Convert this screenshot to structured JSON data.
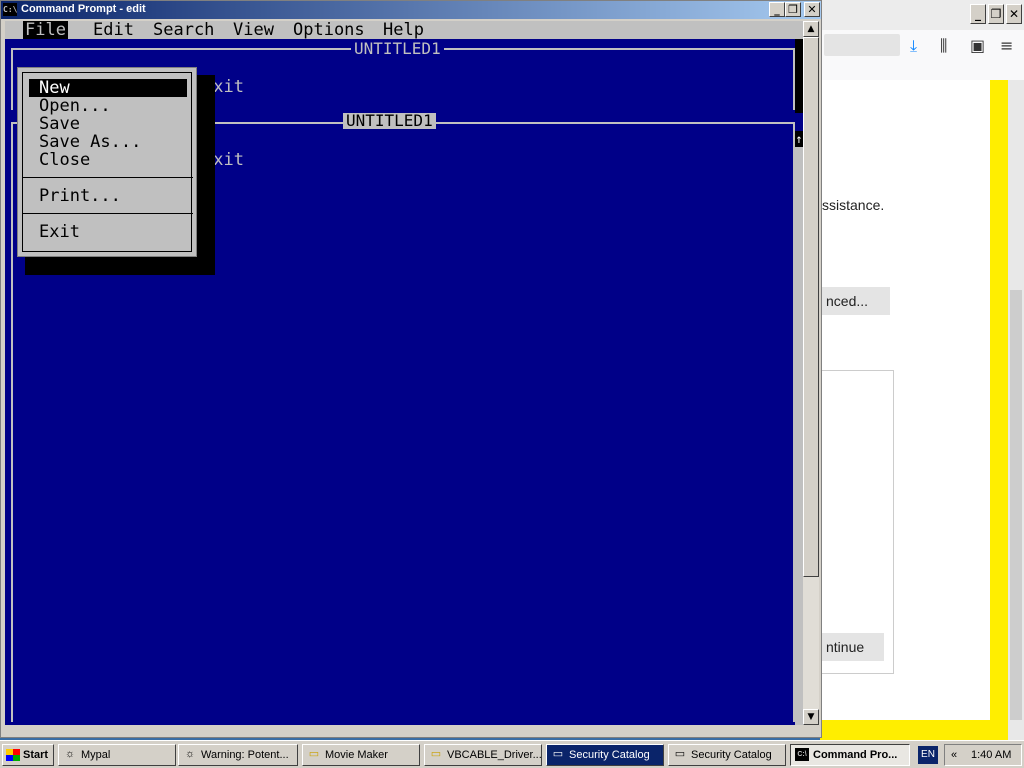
{
  "background_browser": {
    "text_fragments": [
      "ssistance.",
      "nced...",
      "ntinue"
    ],
    "window_buttons": [
      "_",
      "❐",
      "✕"
    ]
  },
  "cmd_window": {
    "title": "Command Prompt - edit",
    "icon_text": "C:\\",
    "buttons": [
      "_",
      "❐",
      "✕"
    ]
  },
  "editor": {
    "menu": [
      "File",
      "Edit",
      "Search",
      "View",
      "Options",
      "Help"
    ],
    "panes": [
      {
        "title": "UNTITLED1",
        "line": "exit"
      },
      {
        "title": "UNTITLED1",
        "line": "exit"
      }
    ],
    "file_menu": {
      "items": [
        "New",
        "Open...",
        "Save",
        "Save As...",
        "Close",
        "Print...",
        "Exit"
      ],
      "selected": "New"
    }
  },
  "taskbar": {
    "start": "Start",
    "tasks": [
      {
        "label": "Mypal",
        "icon": "mypal-icon"
      },
      {
        "label": "Warning: Potent...",
        "icon": "browser-icon"
      },
      {
        "label": "Movie Maker",
        "icon": "folder-icon"
      },
      {
        "label": "VBCABLE_Driver...",
        "icon": "folder-icon"
      },
      {
        "label": "Security Catalog",
        "icon": "window-icon"
      },
      {
        "label": "Security Catalog",
        "icon": "window-icon"
      },
      {
        "label": "Command Pro...",
        "icon": "cmd-icon"
      }
    ],
    "lang": "EN",
    "chevron": "«",
    "clock": "1:40 AM"
  },
  "colors": {
    "console_bg": "#000088",
    "console_fg": "#c0c0c0",
    "title_active": "#0a246a",
    "highlight_yellow": "#ffee00"
  }
}
